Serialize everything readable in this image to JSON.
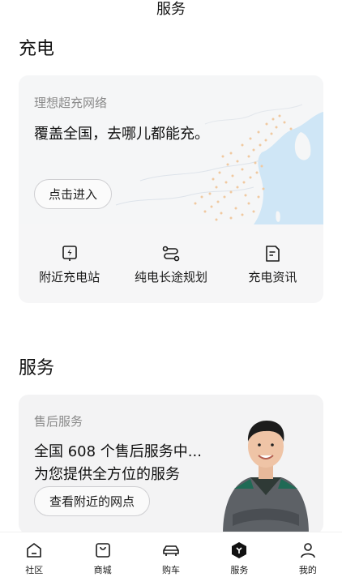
{
  "header": {
    "title": "服务"
  },
  "charging": {
    "section_title": "充电",
    "card_subtitle": "理想超充网络",
    "card_headline": "覆盖全国，去哪儿都能充。",
    "enter_button": "点击进入",
    "quick_links": [
      {
        "label": "附近充电站",
        "icon": "charging-pile-icon"
      },
      {
        "label": "纯电长途规划",
        "icon": "route-icon"
      },
      {
        "label": "充电资讯",
        "icon": "news-icon"
      }
    ]
  },
  "service": {
    "section_title": "服务",
    "card_subtitle": "售后服务",
    "headline_line1": "全国 608 个售后服务中...",
    "headline_line2": "为您提供全方位的服务",
    "nearby_button": "查看附近的网点"
  },
  "tabbar": {
    "tabs": [
      {
        "label": "社区",
        "icon": "home-icon",
        "active": false
      },
      {
        "label": "商城",
        "icon": "shopping-bag-icon",
        "active": false
      },
      {
        "label": "购车",
        "icon": "car-icon",
        "active": false
      },
      {
        "label": "服务",
        "icon": "service-hexagon-icon",
        "active": true
      },
      {
        "label": "我的",
        "icon": "profile-icon",
        "active": false
      }
    ]
  },
  "colors": {
    "map_land": "#f3f4f6",
    "map_sea": "#cfe6f6",
    "map_dots": "#f0c9a0",
    "text_primary": "#111111",
    "text_secondary": "#8a8a8a"
  }
}
